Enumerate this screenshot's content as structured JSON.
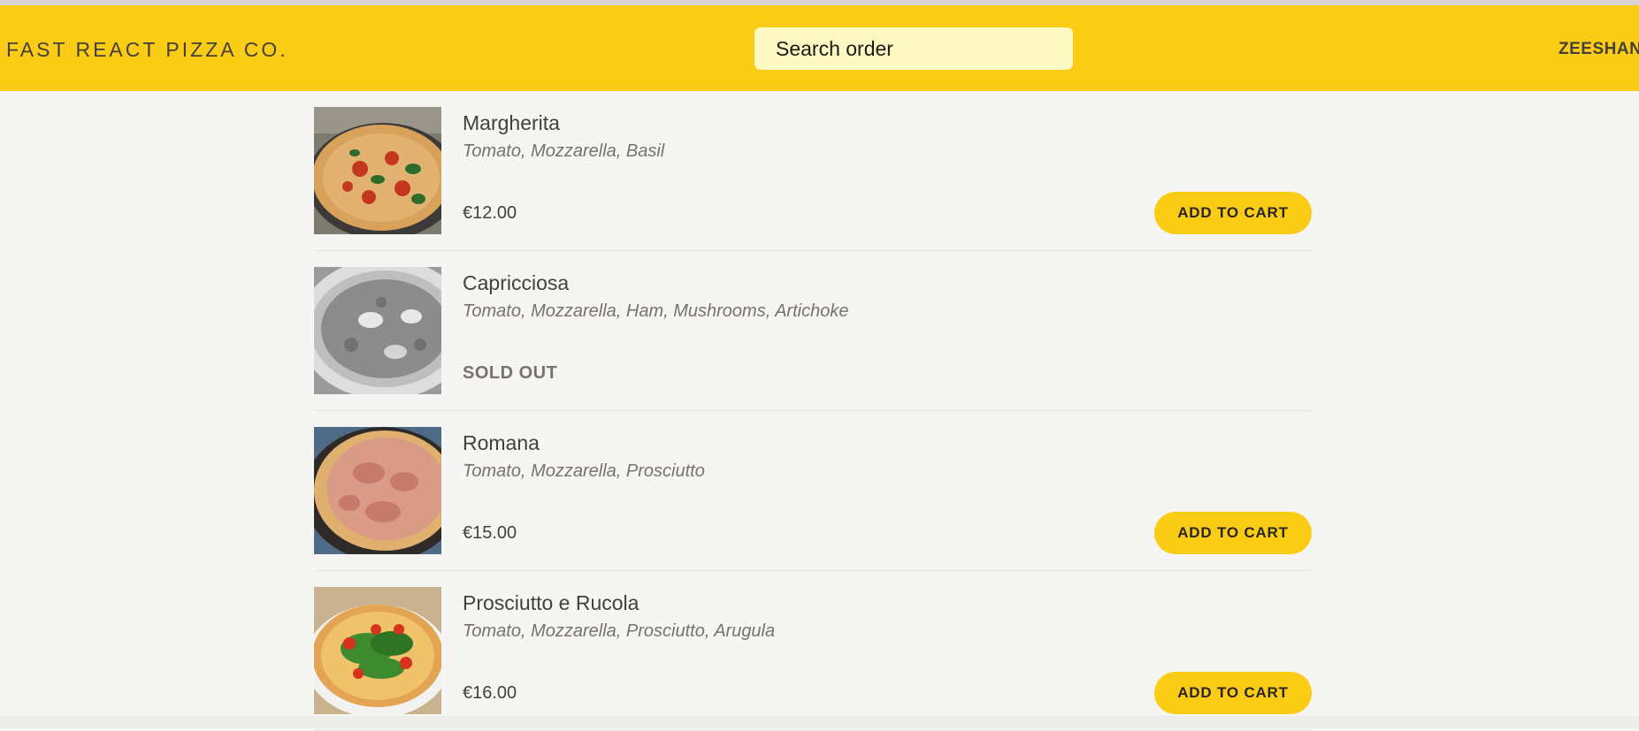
{
  "header": {
    "logo": "FAST REACT PIZZA CO.",
    "search_placeholder": "Search order",
    "username": "ZEESHAN"
  },
  "menu": {
    "items": [
      {
        "name": "Margherita",
        "ingredients": "Tomato, Mozzarella, Basil",
        "price": "€12.00",
        "button": "ADD TO CART",
        "sold_out": false
      },
      {
        "name": "Capricciosa",
        "ingredients": "Tomato, Mozzarella, Ham, Mushrooms, Artichoke",
        "status": "SOLD OUT",
        "sold_out": true
      },
      {
        "name": "Romana",
        "ingredients": "Tomato, Mozzarella, Prosciutto",
        "price": "€15.00",
        "button": "ADD TO CART",
        "sold_out": false
      },
      {
        "name": "Prosciutto e Rucola",
        "ingredients": "Tomato, Mozzarella, Prosciutto, Arugula",
        "price": "€16.00",
        "button": "ADD TO CART",
        "sold_out": false
      }
    ]
  },
  "colors": {
    "brand_yellow": "#facc15",
    "search_bg": "#fef9c3",
    "page_bg": "#f5f5f4"
  }
}
